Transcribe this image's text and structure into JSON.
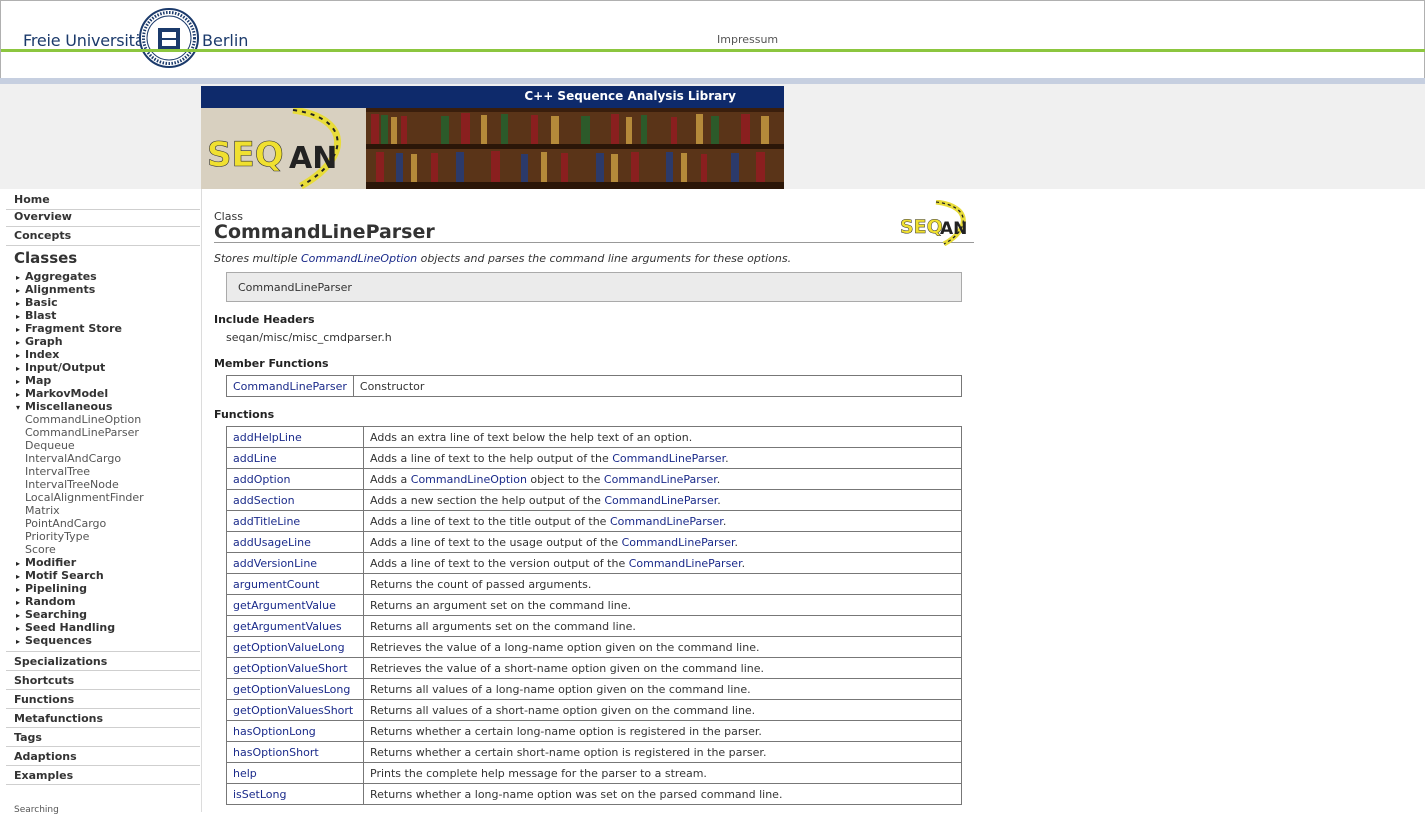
{
  "header": {
    "logo_left": "Freie Universität",
    "logo_right": "Berlin",
    "impressum": "Impressum"
  },
  "banner": {
    "title": "C++ Sequence Analysis Library",
    "logo_text": "SEQAN"
  },
  "sidebar": {
    "home": "Home",
    "overview": "Overview",
    "concepts": "Concepts",
    "classes": "Classes",
    "categories_top": [
      "Aggregates",
      "Alignments",
      "Basic",
      "Blast",
      "Fragment Store",
      "Graph",
      "Index",
      "Input/Output",
      "Map",
      "MarkovModel"
    ],
    "expanded": "Miscellaneous",
    "misc_items": [
      "CommandLineOption",
      "CommandLineParser",
      "Dequeue",
      "IntervalAndCargo",
      "IntervalTree",
      "IntervalTreeNode",
      "LocalAlignmentFinder",
      "Matrix",
      "PointAndCargo",
      "PriorityType",
      "Score"
    ],
    "categories_bottom": [
      "Modifier",
      "Motif Search",
      "Pipelining",
      "Random",
      "Searching",
      "Seed Handling",
      "Sequences"
    ],
    "footer_items": [
      "Specializations",
      "Shortcuts",
      "Functions",
      "Metafunctions",
      "Tags",
      "Adaptions",
      "Examples"
    ],
    "search_label": "Searching"
  },
  "main": {
    "kicker": "Class",
    "title": "CommandLineParser",
    "desc_pre": "Stores multiple ",
    "desc_link": "CommandLineOption",
    "desc_post": " objects and parses the command line arguments for these options.",
    "signature": "CommandLineParser",
    "include_heading": "Include Headers",
    "include_path": "seqan/misc/misc_cmdparser.h",
    "member_heading": "Member Functions",
    "member_functions": [
      {
        "name": "CommandLineParser",
        "desc": "Constructor"
      }
    ],
    "functions_heading": "Functions",
    "functions": [
      {
        "name": "addHelpLine",
        "pre": "Adds an extra line of text below the help text of an option.",
        "link": "",
        "post": ""
      },
      {
        "name": "addLine",
        "pre": "Adds a line of text to the help output of the ",
        "link": "CommandLineParser",
        "post": "."
      },
      {
        "name": "addOption",
        "pre": "Adds a ",
        "link": "CommandLineOption",
        "post": " object to the CommandLineParser.",
        "link2": "CommandLineParser"
      },
      {
        "name": "addSection",
        "pre": "Adds a new section the help output of the ",
        "link": "CommandLineParser",
        "post": "."
      },
      {
        "name": "addTitleLine",
        "pre": "Adds a line of text to the title output of the ",
        "link": "CommandLineParser",
        "post": "."
      },
      {
        "name": "addUsageLine",
        "pre": "Adds a line of text to the usage output of the ",
        "link": "CommandLineParser",
        "post": "."
      },
      {
        "name": "addVersionLine",
        "pre": "Adds a line of text to the version output of the ",
        "link": "CommandLineParser",
        "post": "."
      },
      {
        "name": "argumentCount",
        "pre": "Returns the count of passed arguments.",
        "link": "",
        "post": ""
      },
      {
        "name": "getArgumentValue",
        "pre": "Returns an argument set on the command line.",
        "link": "",
        "post": ""
      },
      {
        "name": "getArgumentValues",
        "pre": "Returns all arguments set on the command line.",
        "link": "",
        "post": ""
      },
      {
        "name": "getOptionValueLong",
        "pre": "Retrieves the value of a long-name option given on the command line.",
        "link": "",
        "post": ""
      },
      {
        "name": "getOptionValueShort",
        "pre": "Retrieves the value of a short-name option given on the command line.",
        "link": "",
        "post": ""
      },
      {
        "name": "getOptionValuesLong",
        "pre": "Returns all values of a long-name option given on the command line.",
        "link": "",
        "post": ""
      },
      {
        "name": "getOptionValuesShort",
        "pre": "Returns all values of a short-name option given on the command line.",
        "link": "",
        "post": ""
      },
      {
        "name": "hasOptionLong",
        "pre": "Returns whether a certain long-name option is registered in the parser.",
        "link": "",
        "post": ""
      },
      {
        "name": "hasOptionShort",
        "pre": "Returns whether a certain short-name option is registered in the parser.",
        "link": "",
        "post": ""
      },
      {
        "name": "help",
        "pre": "Prints the complete help message for the parser to a stream.",
        "link": "",
        "post": ""
      },
      {
        "name": "isSetLong",
        "pre": "Returns whether a long-name option was set on the parsed command line.",
        "link": "",
        "post": ""
      }
    ]
  },
  "colors": {
    "link": "#1a2a8a",
    "fu_green": "#8cc63f",
    "fu_blue": "#1b3a6b",
    "banner_bar": "#0e2a6b"
  }
}
